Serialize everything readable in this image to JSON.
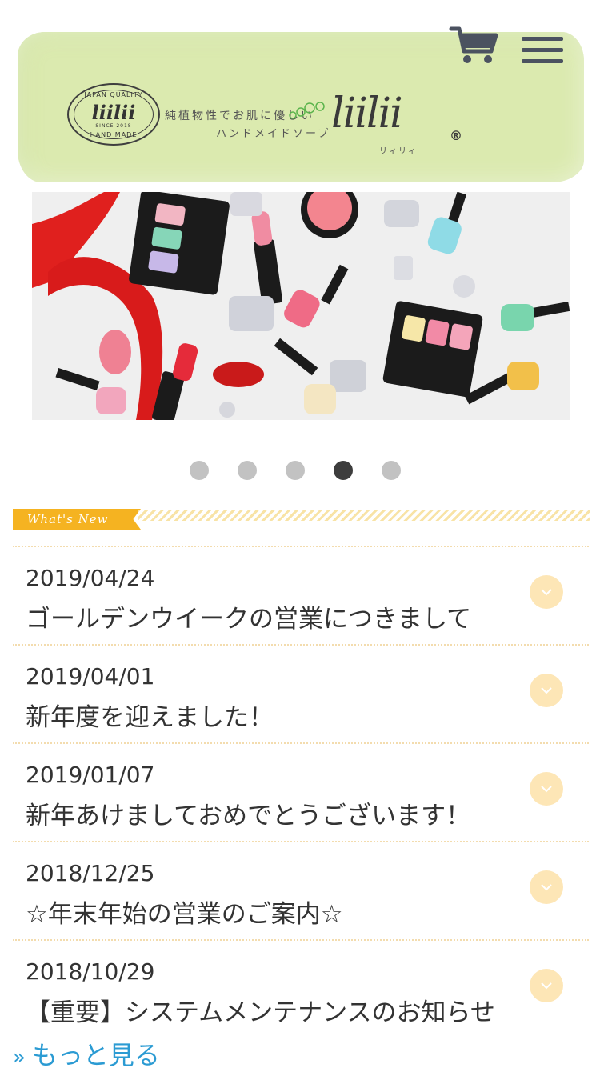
{
  "header": {
    "stamp": {
      "top_text": "JAPAN QUALITY",
      "word": "liilii",
      "since": "SINCE 2018",
      "bottom_text": "HAND MADE"
    },
    "tagline_1": "純植物性でお肌に優しい",
    "tagline_2": "ハンドメイドソープ",
    "logo_word": "liilii",
    "logo_registered": "®",
    "logo_kana": "リィリィ",
    "cart_icon": "shopping-cart-icon",
    "menu_icon": "hamburger-menu-icon",
    "accent_color": "#dbeaaf"
  },
  "carousel": {
    "total_slides": 5,
    "active_index": 3
  },
  "news_section": {
    "heading": "What's New",
    "accent_color": "#f5b321",
    "items": [
      {
        "date": "2019/04/24",
        "title": "ゴールデンウイークの営業につきまして"
      },
      {
        "date": "2019/04/01",
        "title": "新年度を迎えました！"
      },
      {
        "date": "2019/01/07",
        "title": "新年あけましておめでとうございます！"
      },
      {
        "date": "2018/12/25",
        "title": "☆年末年始の営業のご案内☆"
      },
      {
        "date": "2018/10/29",
        "title": "【重要】システムメンテナンスのお知らせ"
      }
    ],
    "more_link": "もっと見る",
    "more_chevron": "»"
  }
}
